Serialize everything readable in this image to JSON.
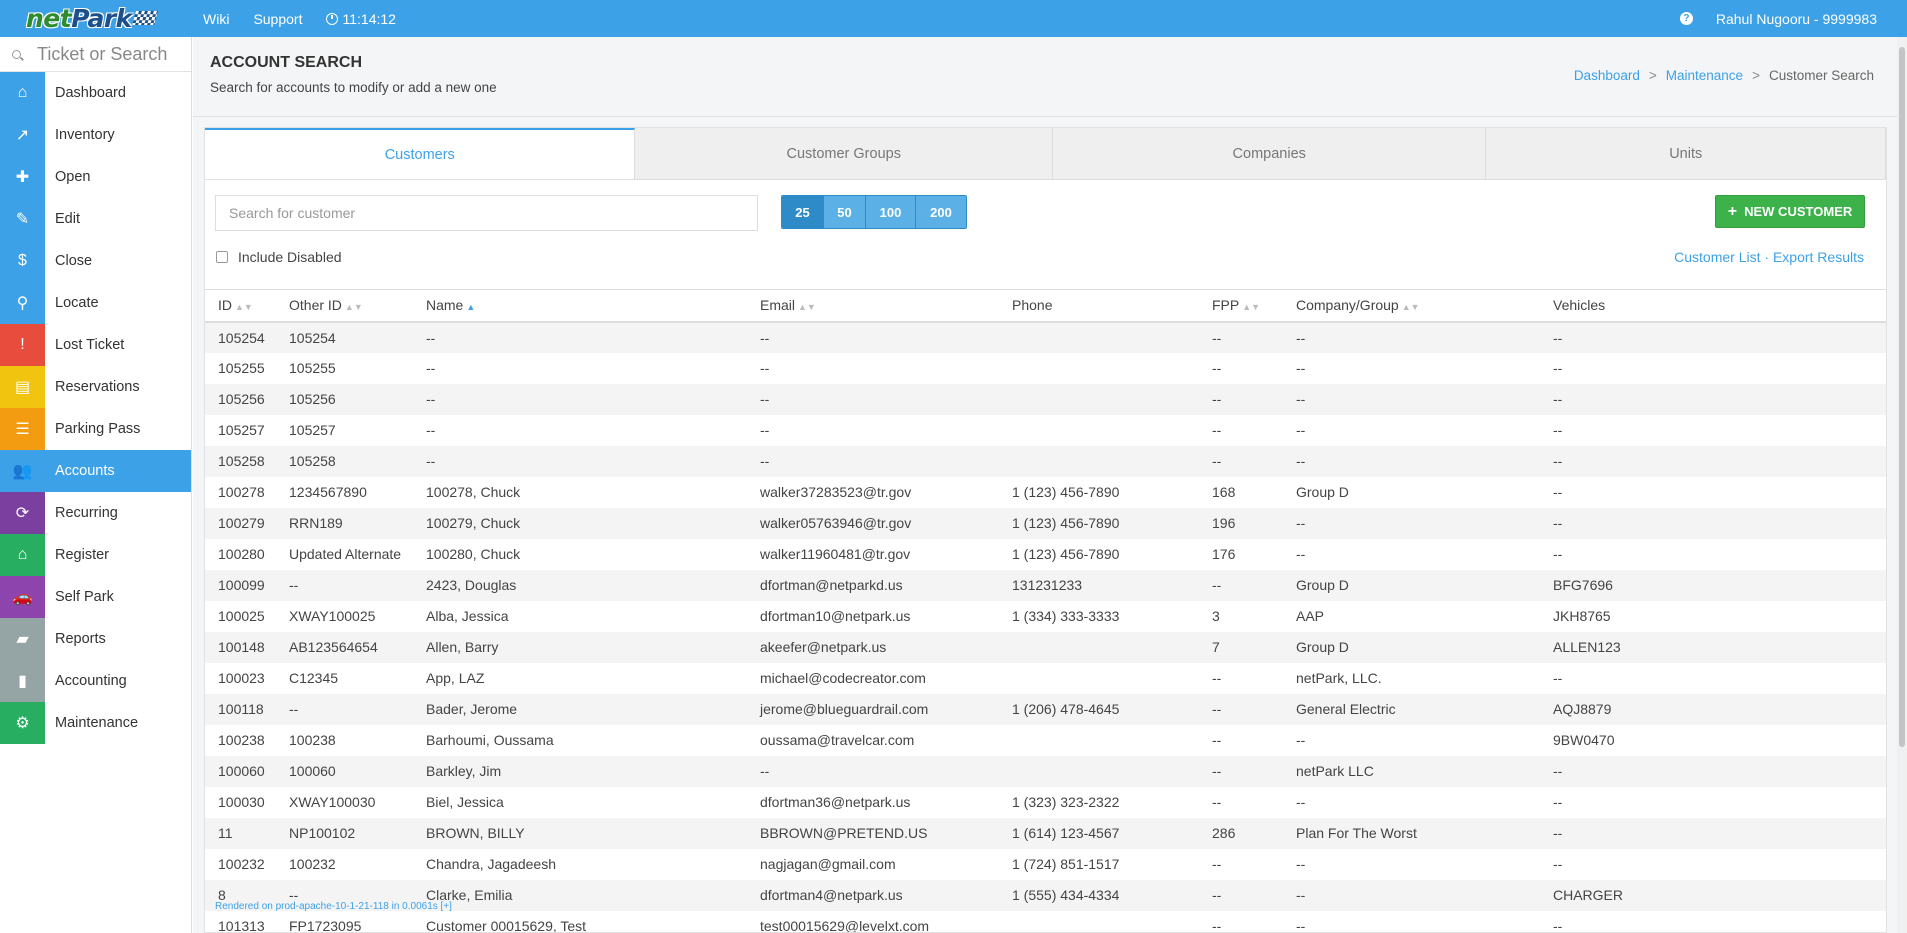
{
  "app": {
    "logo_net": "net",
    "logo_park": "Park",
    "top_links": [
      "Wiki",
      "Support"
    ],
    "clock": "11:14:12",
    "help_icon": "question-circle-icon",
    "user": "Rahul Nugooru - 9999983"
  },
  "sidebar": {
    "search_placeholder": "Ticket or Search",
    "items": [
      {
        "label": "Dashboard",
        "icon": "home-icon",
        "glyph": "⌂",
        "color": "#3da1e8"
      },
      {
        "label": "Inventory",
        "icon": "line-chart-icon",
        "glyph": "↗",
        "color": "#3da1e8"
      },
      {
        "label": "Open",
        "icon": "plus-icon",
        "glyph": "✚",
        "color": "#3da1e8"
      },
      {
        "label": "Edit",
        "icon": "pencil-icon",
        "glyph": "✎",
        "color": "#3da1e8"
      },
      {
        "label": "Close",
        "icon": "dollar-icon",
        "glyph": "$",
        "color": "#3da1e8"
      },
      {
        "label": "Locate",
        "icon": "binoculars-icon",
        "glyph": "⚲",
        "color": "#3da1e8"
      },
      {
        "label": "Lost Ticket",
        "icon": "exclamation-circle-icon",
        "glyph": "!",
        "color": "#e74c3c"
      },
      {
        "label": "Reservations",
        "icon": "file-icon",
        "glyph": "▤",
        "color": "#f1c40f"
      },
      {
        "label": "Parking Pass",
        "icon": "list-icon",
        "glyph": "☰",
        "color": "#f39c12"
      },
      {
        "label": "Accounts",
        "icon": "users-icon",
        "glyph": "👥",
        "color": "#3da1e8",
        "active": true
      },
      {
        "label": "Recurring",
        "icon": "refresh-icon",
        "glyph": "⟳",
        "color": "#7b3fa0"
      },
      {
        "label": "Register",
        "icon": "bank-icon",
        "glyph": "⌂",
        "color": "#27ae60"
      },
      {
        "label": "Self Park",
        "icon": "car-icon",
        "glyph": "🚗",
        "color": "#8e44ad"
      },
      {
        "label": "Reports",
        "icon": "folder-open-icon",
        "glyph": "▰",
        "color": "#95a5a6"
      },
      {
        "label": "Accounting",
        "icon": "bar-chart-icon",
        "glyph": "▮",
        "color": "#95a5a6"
      },
      {
        "label": "Maintenance",
        "icon": "gear-icon",
        "glyph": "⚙",
        "color": "#27ae60"
      }
    ]
  },
  "header": {
    "title": "ACCOUNT SEARCH",
    "subtitle": "Search for accounts to modify or add a new one",
    "breadcrumb": [
      "Dashboard",
      "Maintenance",
      "Customer Search"
    ]
  },
  "tabs": [
    "Customers",
    "Customer Groups",
    "Companies",
    "Units"
  ],
  "toolbar": {
    "search_placeholder": "Search for customer",
    "page_sizes": [
      "25",
      "50",
      "100",
      "200"
    ],
    "selected_page_size": "25",
    "new_button": "NEW CUSTOMER",
    "include_disabled": "Include Disabled",
    "link_customer_list": "Customer List",
    "link_separator": " · ",
    "link_export": "Export Results"
  },
  "table": {
    "columns": [
      "ID",
      "Other ID",
      "Name",
      "Email",
      "Phone",
      "FPP",
      "Company/Group",
      "Vehicles"
    ],
    "rows": [
      [
        "105254",
        "105254",
        "--",
        "--",
        "",
        "--",
        "--",
        "--"
      ],
      [
        "105255",
        "105255",
        "--",
        "--",
        "",
        "--",
        "--",
        "--"
      ],
      [
        "105256",
        "105256",
        "--",
        "--",
        "",
        "--",
        "--",
        "--"
      ],
      [
        "105257",
        "105257",
        "--",
        "--",
        "",
        "--",
        "--",
        "--"
      ],
      [
        "105258",
        "105258",
        "--",
        "--",
        "",
        "--",
        "--",
        "--"
      ],
      [
        "100278",
        "1234567890",
        "100278, Chuck",
        "walker37283523@tr.gov",
        "1 (123) 456-7890",
        "168",
        "Group D",
        "--"
      ],
      [
        "100279",
        "RRN189",
        "100279, Chuck",
        "walker05763946@tr.gov",
        "1 (123) 456-7890",
        "196",
        "--",
        "--"
      ],
      [
        "100280",
        "Updated Alternate",
        "100280, Chuck",
        "walker11960481@tr.gov",
        "1 (123) 456-7890",
        "176",
        "--",
        "--"
      ],
      [
        "100099",
        "--",
        "2423, Douglas",
        "dfortman@netparkd.us",
        "131231233",
        "--",
        "Group D",
        "BFG7696"
      ],
      [
        "100025",
        "XWAY100025",
        "Alba, Jessica",
        "dfortman10@netpark.us",
        "1 (334) 333-3333",
        "3",
        "AAP",
        "JKH8765"
      ],
      [
        "100148",
        "AB123564654",
        "Allen, Barry",
        "akeefer@netpark.us",
        "",
        "7",
        "Group D",
        "ALLEN123"
      ],
      [
        "100023",
        "C12345",
        "App, LAZ",
        "michael@codecreator.com",
        "",
        "--",
        "netPark, LLC.",
        "--"
      ],
      [
        "100118",
        "--",
        "Bader, Jerome",
        "jerome@blueguardrail.com",
        "1 (206) 478-4645",
        "--",
        "General Electric",
        "AQJ8879"
      ],
      [
        "100238",
        "100238",
        "Barhoumi, Oussama",
        "oussama@travelcar.com",
        "",
        "--",
        "--",
        "9BW0470"
      ],
      [
        "100060",
        "100060",
        "Barkley, Jim",
        "--",
        "",
        "--",
        "netPark LLC",
        "--"
      ],
      [
        "100030",
        "XWAY100030",
        "Biel, Jessica",
        "dfortman36@netpark.us",
        "1 (323) 323-2322",
        "--",
        "--",
        "--"
      ],
      [
        "11",
        "NP100102",
        "BROWN, BILLY",
        "BBROWN@PRETEND.US",
        "1 (614) 123-4567",
        "286",
        "Plan For The Worst",
        "--"
      ],
      [
        "100232",
        "100232",
        "Chandra, Jagadeesh",
        "nagjagan@gmail.com",
        "1 (724) 851-1517",
        "--",
        "--",
        "--"
      ],
      [
        "8",
        "--",
        "Clarke, Emilia",
        "dfortman4@netpark.us",
        "1 (555) 434-4334",
        "--",
        "--",
        "CHARGER"
      ],
      [
        "101313",
        "FP1723095",
        "Customer 00015629, Test",
        "test00015629@levelxt.com",
        "",
        "--",
        "--",
        "--"
      ]
    ]
  },
  "footer_note": "Rendered on prod-apache-10-1-21-118 in 0.0061s [+]"
}
